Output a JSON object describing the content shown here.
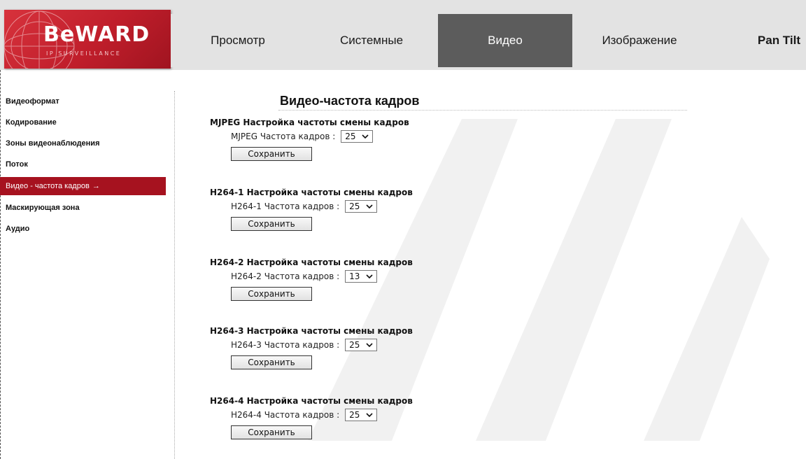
{
  "brand": {
    "name": "BeWARD",
    "tagline": "IP SURVEILLANCE"
  },
  "tabs": [
    {
      "label": "Просмотр",
      "active": false
    },
    {
      "label": "Системные",
      "active": false
    },
    {
      "label": "Видео",
      "active": true
    },
    {
      "label": "Изображение",
      "active": false
    },
    {
      "label": "Pan Tilt",
      "active": false
    }
  ],
  "sidebar": {
    "items": [
      {
        "label": "Видеоформат"
      },
      {
        "label": "Кодирование"
      },
      {
        "label": "Зоны видеонаблюдения"
      },
      {
        "label": "Поток"
      },
      {
        "label": "Видео - частота кадров",
        "active": true,
        "arrow": "→"
      },
      {
        "label": "Маскирующая зона"
      },
      {
        "label": "Аудио"
      }
    ]
  },
  "page": {
    "title": "Видео-частота кадров"
  },
  "sections": [
    {
      "heading": "MJPEG Настройка частоты смены кадров",
      "field_label": "MJPEG Частота кадров :",
      "value": "25",
      "save_label": "Сохранить"
    },
    {
      "heading": "H264-1 Настройка частоты смены кадров",
      "field_label": "H264-1 Частота кадров :",
      "value": "25",
      "save_label": "Сохранить"
    },
    {
      "heading": "H264-2 Настройка частоты смены кадров",
      "field_label": "H264-2 Частота кадров :",
      "value": "13",
      "save_label": "Сохранить"
    },
    {
      "heading": "H264-3 Настройка частоты смены кадров",
      "field_label": "H264-3 Частота кадров :",
      "value": "25",
      "save_label": "Сохранить"
    },
    {
      "heading": "H264-4 Настройка частоты смены кадров",
      "field_label": "H264-4 Частота кадров :",
      "value": "25",
      "save_label": "Сохранить"
    }
  ],
  "colors": {
    "brand_red": "#c01e2b",
    "active_tab": "#5c5c5c",
    "active_side": "#a6121f",
    "header_bg": "#e3e3e3"
  },
  "icons": {
    "select_chevron": "chevron-down-icon",
    "active_arrow": "arrow-right-icon"
  }
}
